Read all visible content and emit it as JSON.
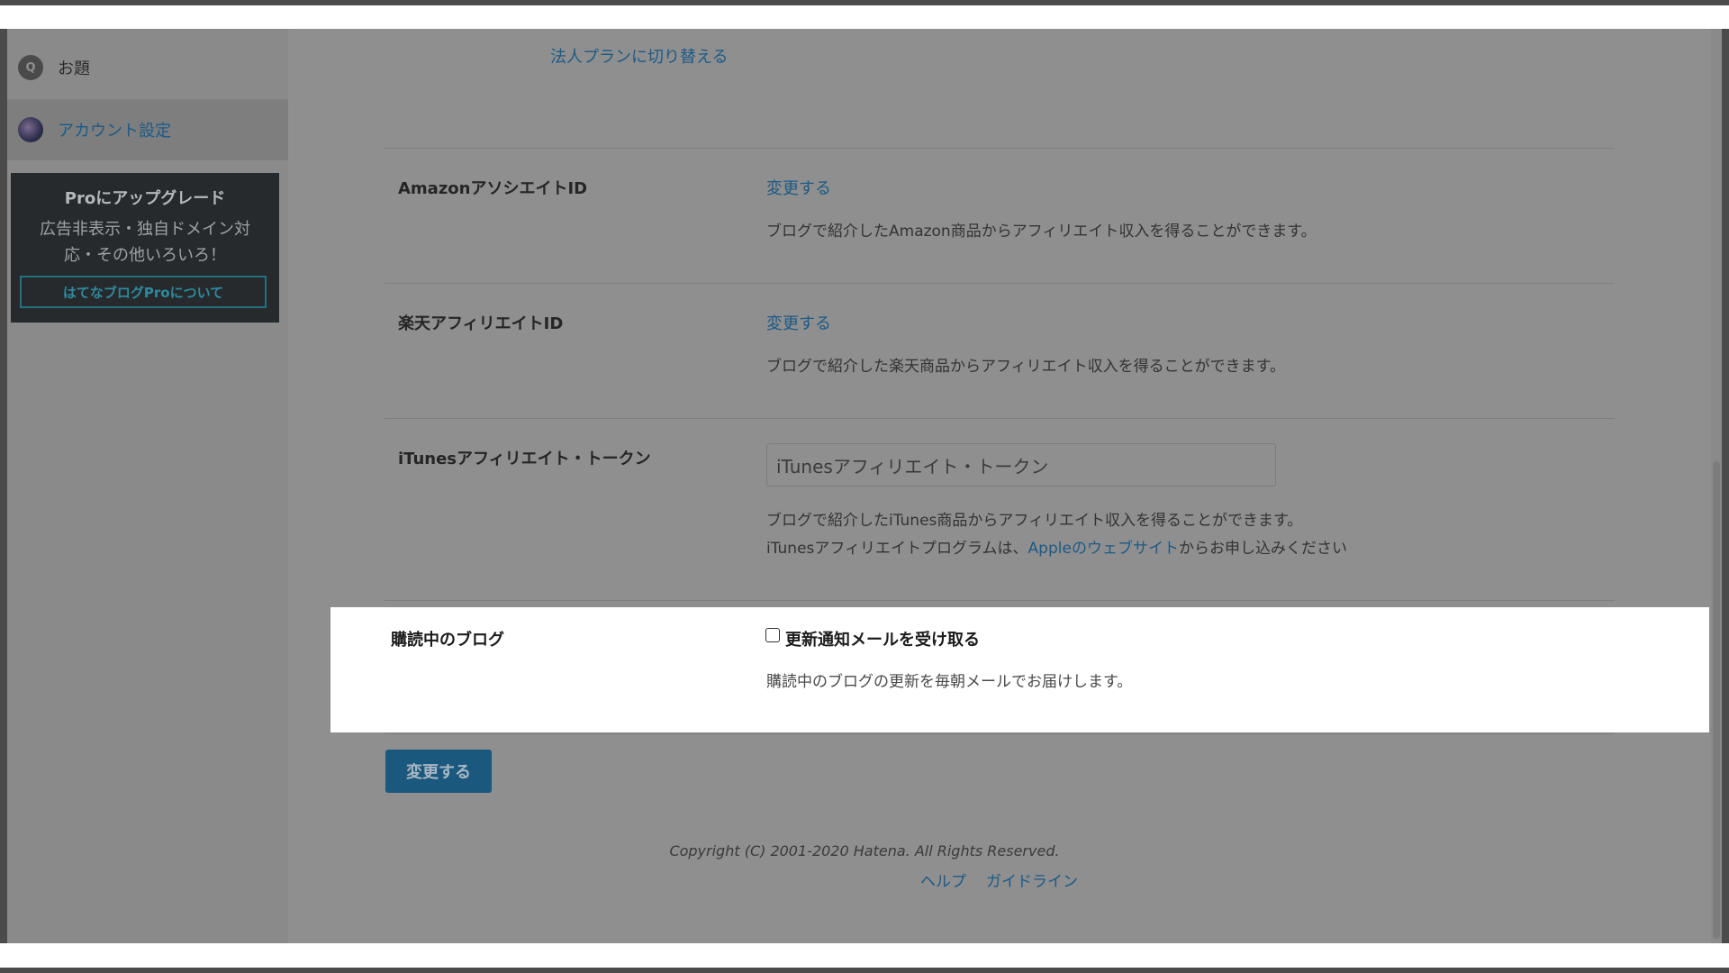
{
  "sidebar": {
    "items": [
      {
        "label": "お題",
        "icon": "question-icon"
      },
      {
        "label": "アカウント設定",
        "icon": "avatar"
      }
    ],
    "pro_box": {
      "title": "Proにアップグレード",
      "description_line1": "広告非表示・独自ドメイン対",
      "description_line2": "応・その他いろいろ！",
      "button_label": "はてなブログProについて"
    }
  },
  "main": {
    "corporate_plan_link": "法人プランに切り替える",
    "amazon": {
      "label": "AmazonアソシエイトID",
      "change_label": "変更する",
      "description": "ブログで紹介したAmazon商品からアフィリエイト収入を得ることができます。"
    },
    "rakuten": {
      "label": "楽天アフィリエイトID",
      "change_label": "変更する",
      "description": "ブログで紹介した楽天商品からアフィリエイト収入を得ることができます。"
    },
    "itunes": {
      "label": "iTunesアフィリエイト・トークン",
      "input_placeholder": "iTunesアフィリエイト・トークン",
      "description_line1": "ブログで紹介したiTunes商品からアフィリエイト収入を得ることができます。",
      "description_line2_prefix": "iTunesアフィリエイトプログラムは、",
      "description_link": "Appleのウェブサイト",
      "description_line2_suffix": "からお申し込みください"
    },
    "subscribed_blogs": {
      "label": "購読中のブログ",
      "checkbox_label": "更新通知メールを受け取る",
      "checkbox_checked": false,
      "description": "購読中のブログの更新を毎朝メールでお届けします。"
    },
    "submit_label": "変更する"
  },
  "footer": {
    "copyright": "Copyright (C) 2001-2020 Hatena. All Rights Reserved.",
    "links": [
      "ヘルプ",
      "ガイドライン"
    ]
  },
  "colors": {
    "overlay_bg": "#8f8f8f",
    "link": "#1c5a86",
    "pro_box_bg": "#262a2d",
    "submit_bg": "#1b587e"
  }
}
